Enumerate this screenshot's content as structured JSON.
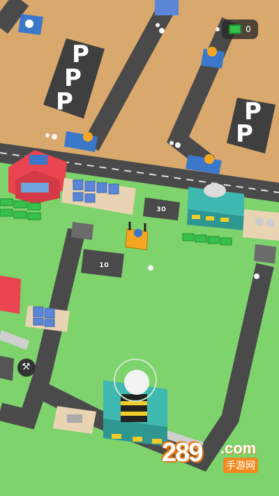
{
  "hud": {
    "cash_value": "0",
    "cash_icon": "cash-stack-icon"
  },
  "zones": {
    "collect_top_value": "30",
    "collect_mid_value": "10"
  },
  "parking": {
    "sign_letter": "P"
  },
  "watermark": {
    "number": "289",
    "suffix": ".com",
    "chinese": "手游网"
  },
  "colors": {
    "grass": "#7ed36d",
    "road": "#4a4a4a",
    "dirt": "#d9a86c",
    "cash": "#35c14a",
    "factory_roof": "#3fb8b0"
  }
}
